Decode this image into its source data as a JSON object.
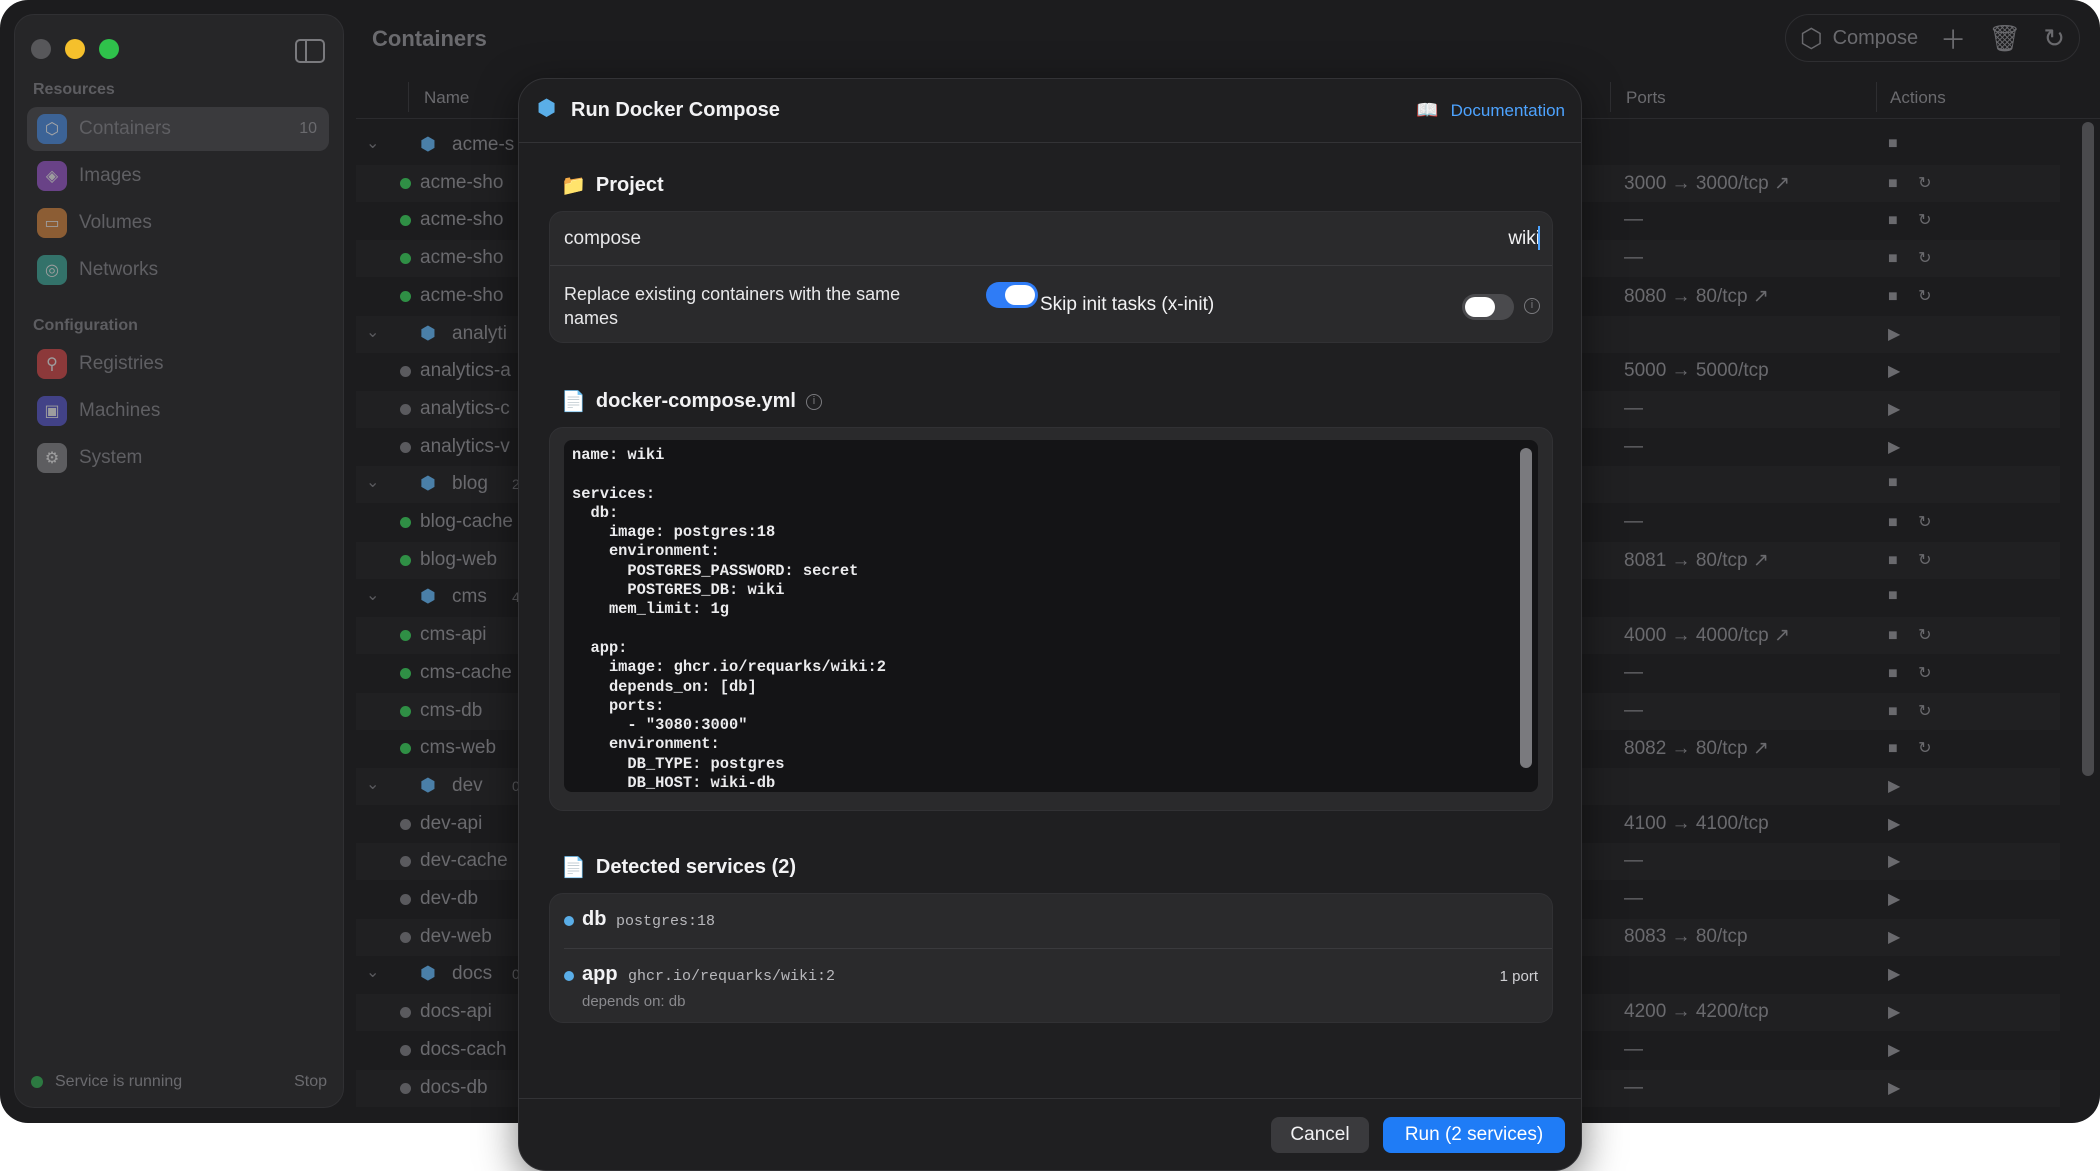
{
  "sidebar": {
    "resources_label": "Resources",
    "configuration_label": "Configuration",
    "items": [
      {
        "label": "Containers",
        "count": "10",
        "icon": "containers-icon",
        "color": "#3f86e0"
      },
      {
        "label": "Images",
        "icon": "images-icon",
        "color": "#a05ad6"
      },
      {
        "label": "Volumes",
        "icon": "volumes-icon",
        "color": "#e08a3f"
      },
      {
        "label": "Networks",
        "icon": "networks-icon",
        "color": "#3fb0a0"
      },
      {
        "label": "Registries",
        "icon": "registries-icon",
        "color": "#e04a4a"
      },
      {
        "label": "Machines",
        "icon": "machines-icon",
        "color": "#5a5ad6"
      },
      {
        "label": "System",
        "icon": "gear-icon",
        "color": "#8a8a8e"
      }
    ],
    "status_text": "Service is running",
    "stop_label": "Stop"
  },
  "header": {
    "title": "Containers",
    "compose_label": "Compose"
  },
  "table": {
    "columns": {
      "name": "Name",
      "ports": "Ports",
      "actions": "Actions"
    },
    "rows": [
      {
        "kind": "group",
        "name": "acme-s",
        "count": "",
        "port": "",
        "actions": "■"
      },
      {
        "kind": "item",
        "status": "run",
        "name": "acme-sho",
        "port": "3000 → 3000/tcp ↗",
        "actions": "■ ↻"
      },
      {
        "kind": "item",
        "status": "run",
        "name": "acme-sho",
        "port": "—",
        "actions": "■ ↻"
      },
      {
        "kind": "item",
        "status": "run",
        "name": "acme-sho",
        "port": "—",
        "actions": "■ ↻"
      },
      {
        "kind": "item",
        "status": "run",
        "name": "acme-sho",
        "port": "8080 → 80/tcp ↗",
        "actions": "■ ↻"
      },
      {
        "kind": "group",
        "name": "analyti",
        "count": "",
        "port": "",
        "actions": "▶"
      },
      {
        "kind": "item",
        "status": "stop",
        "name": "analytics-a",
        "port": "5000 → 5000/tcp",
        "actions": "▶"
      },
      {
        "kind": "item",
        "status": "stop",
        "name": "analytics-c",
        "port": "—",
        "actions": "▶"
      },
      {
        "kind": "item",
        "status": "stop",
        "name": "analytics-v",
        "port": "—",
        "actions": "▶"
      },
      {
        "kind": "group",
        "name": "blog",
        "count": "2/",
        "port": "",
        "actions": "■"
      },
      {
        "kind": "item",
        "status": "run",
        "name": "blog-cache",
        "port": "—",
        "actions": "■ ↻"
      },
      {
        "kind": "item",
        "status": "run",
        "name": "blog-web",
        "port": "8081 → 80/tcp ↗",
        "actions": "■ ↻"
      },
      {
        "kind": "group",
        "name": "cms",
        "count": "4/",
        "port": "",
        "actions": "■"
      },
      {
        "kind": "item",
        "status": "run",
        "name": "cms-api",
        "port": "4000 → 4000/tcp ↗",
        "actions": "■ ↻"
      },
      {
        "kind": "item",
        "status": "run",
        "name": "cms-cache",
        "port": "—",
        "actions": "■ ↻"
      },
      {
        "kind": "item",
        "status": "run",
        "name": "cms-db",
        "port": "—",
        "actions": "■ ↻"
      },
      {
        "kind": "item",
        "status": "run",
        "name": "cms-web",
        "port": "8082 → 80/tcp ↗",
        "actions": "■ ↻"
      },
      {
        "kind": "group",
        "name": "dev",
        "count": "0/4",
        "port": "",
        "actions": "▶"
      },
      {
        "kind": "item",
        "status": "stop",
        "name": "dev-api",
        "port": "4100 → 4100/tcp",
        "actions": "▶"
      },
      {
        "kind": "item",
        "status": "stop",
        "name": "dev-cache",
        "port": "—",
        "actions": "▶"
      },
      {
        "kind": "item",
        "status": "stop",
        "name": "dev-db",
        "port": "—",
        "actions": "▶"
      },
      {
        "kind": "item",
        "status": "stop",
        "name": "dev-web",
        "port": "8083 → 80/tcp",
        "actions": "▶"
      },
      {
        "kind": "group",
        "name": "docs",
        "count": "0/",
        "port": "",
        "actions": "▶"
      },
      {
        "kind": "item",
        "status": "stop",
        "name": "docs-api",
        "port": "4200 → 4200/tcp",
        "actions": "▶"
      },
      {
        "kind": "item",
        "status": "stop",
        "name": "docs-cach",
        "port": "—",
        "actions": "▶"
      },
      {
        "kind": "item",
        "status": "stop",
        "name": "docs-db",
        "port": "—",
        "actions": "▶"
      }
    ]
  },
  "modal": {
    "title": "Run Docker Compose",
    "documentation_label": "Documentation",
    "project_heading": "Project",
    "project_label": "compose",
    "project_value": "wiki",
    "replace_label": "Replace existing containers with the same names",
    "replace_on": true,
    "skip_label": "Skip init tasks (x-init)",
    "skip_on": false,
    "file_heading": "docker-compose.yml",
    "yaml": "name: wiki\n\nservices:\n  db:\n    image: postgres:18\n    environment:\n      POSTGRES_PASSWORD: secret\n      POSTGRES_DB: wiki\n    mem_limit: 1g\n\n  app:\n    image: ghcr.io/requarks/wiki:2\n    depends_on: [db]\n    ports:\n      - \"3080:3000\"\n    environment:\n      DB_TYPE: postgres\n      DB_HOST: wiki-db\n      DB_PASS: secret",
    "services_heading": "Detected services (2)",
    "services": [
      {
        "name": "db",
        "image": "postgres:18",
        "depends": "",
        "ports": ""
      },
      {
        "name": "app",
        "image": "ghcr.io/requarks/wiki:2",
        "depends": "depends on: db",
        "ports": "1 port"
      }
    ],
    "cancel_label": "Cancel",
    "run_label": "Run (2 services)"
  },
  "colors": {
    "accent": "#1f7cf6",
    "link": "#4da3ff",
    "running": "#2f8f45"
  }
}
